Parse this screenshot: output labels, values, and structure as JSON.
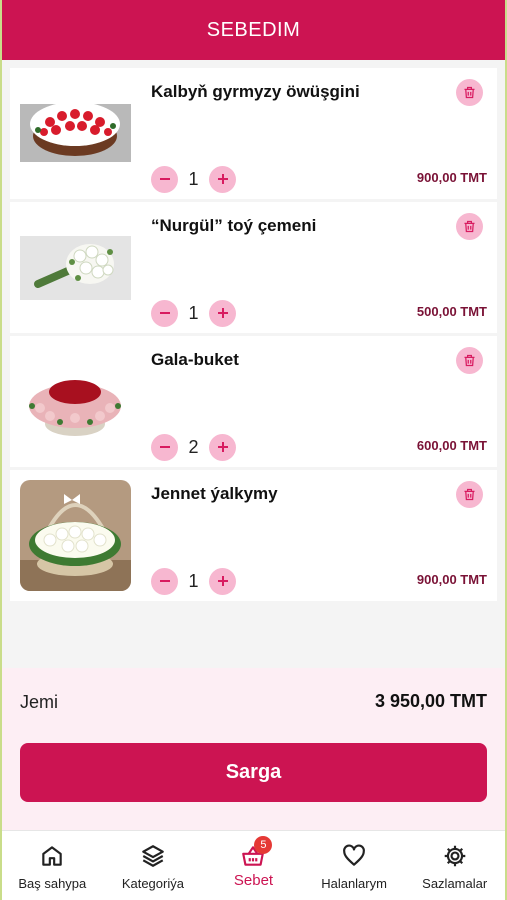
{
  "header": {
    "title": "SEBEDIM"
  },
  "cart": {
    "items": [
      {
        "name": "Kalbyň gyrmyzy öwüşgini",
        "quantity": "1",
        "price": "900,00 TMT",
        "image": "red-white-rose-basket"
      },
      {
        "name": "“Nurgül” toý çemeni",
        "quantity": "1",
        "price": "500,00 TMT",
        "image": "white-rose-bouquet"
      },
      {
        "name": "Gala-buket",
        "quantity": "2",
        "price": "600,00 TMT",
        "image": "heart-rose-basket"
      },
      {
        "name": "Jennet ýalkymy",
        "quantity": "1",
        "price": "900,00 TMT",
        "image": "white-rose-basket"
      }
    ]
  },
  "summary": {
    "total_label": "Jemi",
    "total_value": "3 950,00 TMT",
    "order_button": "Sarga"
  },
  "nav": {
    "items": [
      {
        "label": "Baş sahypa",
        "icon": "home-icon"
      },
      {
        "label": "Kategoriýa",
        "icon": "layers-icon"
      },
      {
        "label": "Sebet",
        "icon": "basket-icon",
        "badge": "5"
      },
      {
        "label": "Halanlarym",
        "icon": "heart-icon"
      },
      {
        "label": "Sazlamalar",
        "icon": "gear-icon"
      }
    ]
  },
  "colors": {
    "primary": "#cc1452",
    "light_pink": "#f7b7d0",
    "price": "#7a1236",
    "summary_bg": "#fdeef4"
  }
}
